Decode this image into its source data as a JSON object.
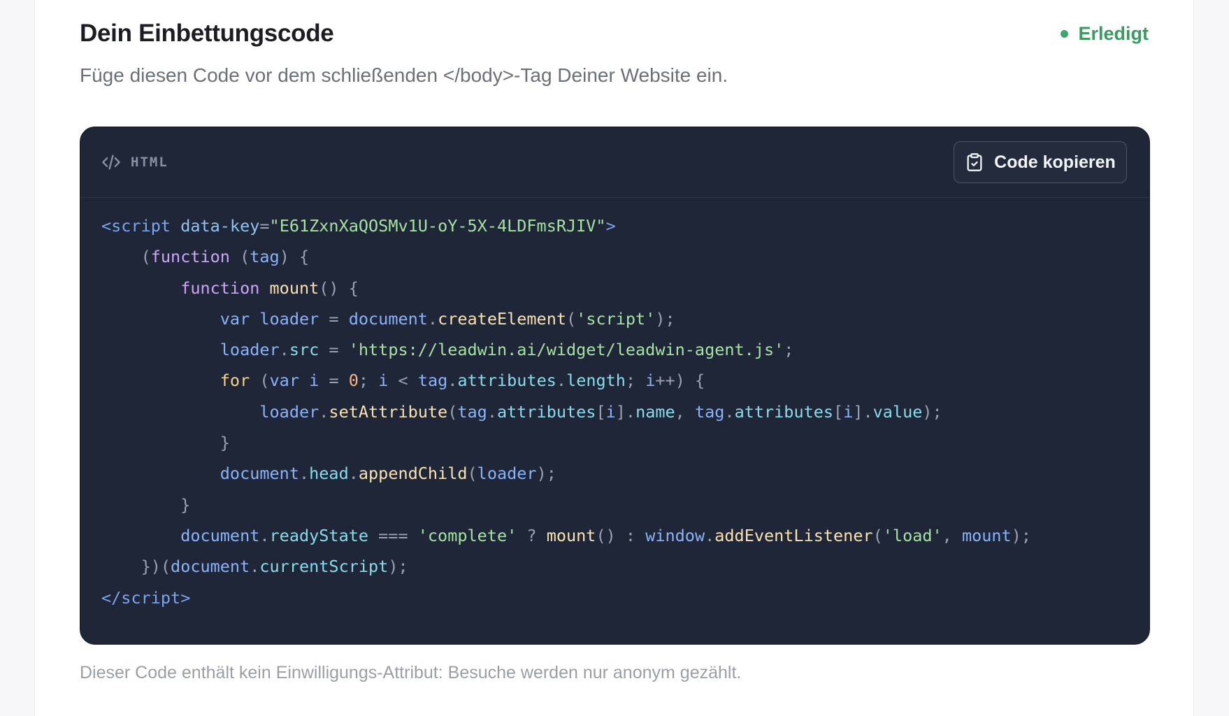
{
  "section": {
    "title": "Dein Einbettungscode",
    "status_label": "Erledigt",
    "status_color": "#3aa86b",
    "subtitle": "Füge diesen Code vor dem schließenden </body>-Tag Deiner Website ein."
  },
  "code_panel": {
    "language_icon": "code-brackets-icon",
    "language_label": "HTML",
    "copy_icon": "clipboard-check-icon",
    "copy_label": "Code kopieren",
    "lines": [
      [
        [
          "tag",
          "<script"
        ],
        [
          "p",
          " "
        ],
        [
          "attr",
          "data-key"
        ],
        [
          "p",
          "="
        ],
        [
          "str",
          "\"E61ZxnXaQOSMv1U-oY-5X-4LDFmsRJIV\""
        ],
        [
          "tag",
          ">"
        ]
      ],
      [
        [
          "p",
          "    ("
        ],
        [
          "kw",
          "function"
        ],
        [
          "p",
          " ("
        ],
        [
          "var",
          "tag"
        ],
        [
          "p",
          ") {"
        ]
      ],
      [
        [
          "p",
          "        "
        ],
        [
          "kw",
          "function"
        ],
        [
          "p",
          " "
        ],
        [
          "fn",
          "mount"
        ],
        [
          "p",
          "() {"
        ]
      ],
      [
        [
          "p",
          "            "
        ],
        [
          "var",
          "var"
        ],
        [
          "p",
          " "
        ],
        [
          "var",
          "loader"
        ],
        [
          "p",
          " = "
        ],
        [
          "var",
          "document"
        ],
        [
          "p",
          "."
        ],
        [
          "fn",
          "createElement"
        ],
        [
          "p",
          "("
        ],
        [
          "str",
          "'script'"
        ],
        [
          "p",
          ");"
        ]
      ],
      [
        [
          "p",
          "            "
        ],
        [
          "var",
          "loader"
        ],
        [
          "p",
          "."
        ],
        [
          "prop",
          "src"
        ],
        [
          "p",
          " = "
        ],
        [
          "str",
          "'https://leadwin.ai/widget/leadwin-agent.js'"
        ],
        [
          "p",
          ";"
        ]
      ],
      [
        [
          "p",
          "            "
        ],
        [
          "loop",
          "for"
        ],
        [
          "p",
          " ("
        ],
        [
          "var",
          "var"
        ],
        [
          "p",
          " "
        ],
        [
          "var",
          "i"
        ],
        [
          "p",
          " = "
        ],
        [
          "num",
          "0"
        ],
        [
          "p",
          "; "
        ],
        [
          "var",
          "i"
        ],
        [
          "p",
          " < "
        ],
        [
          "var",
          "tag"
        ],
        [
          "p",
          "."
        ],
        [
          "prop",
          "attributes"
        ],
        [
          "p",
          "."
        ],
        [
          "prop",
          "length"
        ],
        [
          "p",
          "; "
        ],
        [
          "var",
          "i"
        ],
        [
          "p",
          "++) {"
        ]
      ],
      [
        [
          "p",
          "                "
        ],
        [
          "var",
          "loader"
        ],
        [
          "p",
          "."
        ],
        [
          "fn",
          "setAttribute"
        ],
        [
          "p",
          "("
        ],
        [
          "var",
          "tag"
        ],
        [
          "p",
          "."
        ],
        [
          "prop",
          "attributes"
        ],
        [
          "p",
          "["
        ],
        [
          "var",
          "i"
        ],
        [
          "p",
          "]."
        ],
        [
          "prop",
          "name"
        ],
        [
          "p",
          ", "
        ],
        [
          "var",
          "tag"
        ],
        [
          "p",
          "."
        ],
        [
          "prop",
          "attributes"
        ],
        [
          "p",
          "["
        ],
        [
          "var",
          "i"
        ],
        [
          "p",
          "]."
        ],
        [
          "prop",
          "value"
        ],
        [
          "p",
          ");"
        ]
      ],
      [
        [
          "p",
          "            }"
        ]
      ],
      [
        [
          "p",
          "            "
        ],
        [
          "var",
          "document"
        ],
        [
          "p",
          "."
        ],
        [
          "prop",
          "head"
        ],
        [
          "p",
          "."
        ],
        [
          "fn",
          "appendChild"
        ],
        [
          "p",
          "("
        ],
        [
          "var",
          "loader"
        ],
        [
          "p",
          ");"
        ]
      ],
      [
        [
          "p",
          "        }"
        ]
      ],
      [
        [
          "p",
          "        "
        ],
        [
          "var",
          "document"
        ],
        [
          "p",
          "."
        ],
        [
          "prop",
          "readyState"
        ],
        [
          "p",
          " === "
        ],
        [
          "str",
          "'complete'"
        ],
        [
          "p",
          " ? "
        ],
        [
          "fn",
          "mount"
        ],
        [
          "p",
          "() : "
        ],
        [
          "var",
          "window"
        ],
        [
          "p",
          "."
        ],
        [
          "fn",
          "addEventListener"
        ],
        [
          "p",
          "("
        ],
        [
          "str",
          "'load'"
        ],
        [
          "p",
          ", "
        ],
        [
          "var",
          "mount"
        ],
        [
          "p",
          ");"
        ]
      ],
      [
        [
          "p",
          "    })("
        ],
        [
          "var",
          "document"
        ],
        [
          "p",
          "."
        ],
        [
          "prop",
          "currentScript"
        ],
        [
          "p",
          ");"
        ]
      ],
      [
        [
          "tag",
          "</script"
        ],
        [
          "tag",
          ">"
        ]
      ]
    ]
  },
  "footnote": "Dieser Code enthält kein Einwilligungs-Attribut: Besuche werden nur anonym gezählt."
}
